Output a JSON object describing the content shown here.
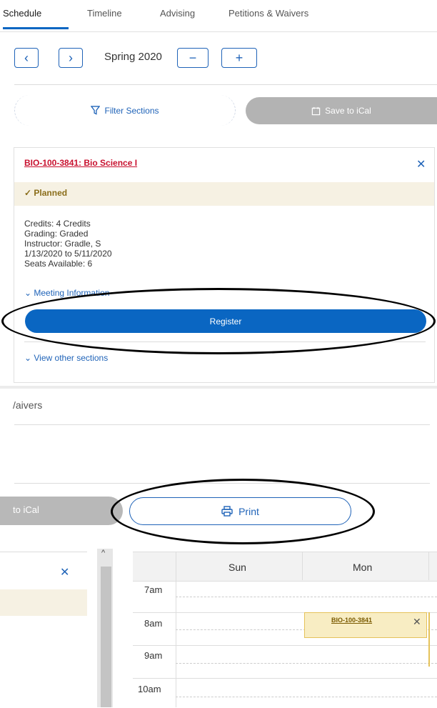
{
  "tabs": [
    "Schedule",
    "Timeline",
    "Advising",
    "Petitions & Waivers"
  ],
  "term_nav": {
    "prev": "‹",
    "next": "›",
    "term": "Spring 2020",
    "remove": "−",
    "add": "+"
  },
  "toolbar": {
    "filter_label": "Filter Sections",
    "ical_label": "Save to iCal"
  },
  "course": {
    "title": "BIO-100-3841: Bio Science I",
    "status": "Planned",
    "details": [
      "Credits: 4 Credits",
      "Grading: Graded",
      "Instructor: Gradle, S",
      "1/13/2020 to 5/11/2020",
      "Seats Available:  6"
    ],
    "meeting_info": "Meeting Information",
    "register": "Register",
    "view_other": "View other sections"
  },
  "lower": {
    "waivers_fragment": "/aivers",
    "ical_fragment": "to iCal",
    "print": "Print"
  },
  "calendar": {
    "days": [
      "Sun",
      "Mon"
    ],
    "times": [
      "7am",
      "8am",
      "9am",
      "10am"
    ],
    "event_label": "BIO-100-3841"
  },
  "colors": {
    "accent": "#0a66c2",
    "link_red": "#c8102e",
    "planned_bg": "#f6f1e3"
  }
}
